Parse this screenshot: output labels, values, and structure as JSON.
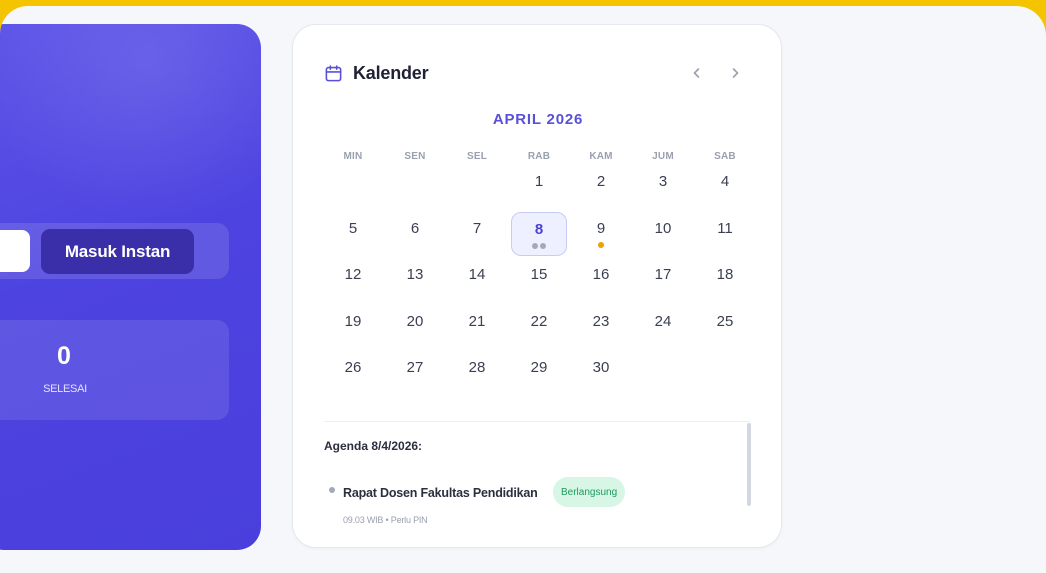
{
  "hero": {
    "instant_button_label": "Masuk Instan",
    "stat_value": "0",
    "stat_label": "SELESAI",
    "accent": "#4d43e0"
  },
  "calendar": {
    "title": "Kalender",
    "icon": "calendar-icon",
    "prev_icon": "chevron-left-icon",
    "next_icon": "chevron-right-icon",
    "month_label": "APRIL 2026",
    "weekdays": [
      "MIN",
      "SEN",
      "SEL",
      "RAB",
      "KAM",
      "JUM",
      "SAB"
    ],
    "weeks": [
      [
        "",
        "",
        "",
        "1",
        "2",
        "3",
        "4"
      ],
      [
        "5",
        "6",
        "7",
        "8",
        "9",
        "10",
        "11"
      ],
      [
        "12",
        "13",
        "14",
        "15",
        "16",
        "17",
        "18"
      ],
      [
        "19",
        "20",
        "21",
        "22",
        "23",
        "24",
        "25"
      ],
      [
        "26",
        "27",
        "28",
        "29",
        "30",
        "",
        ""
      ]
    ],
    "selected_day": "8",
    "event_dots": {
      "8": [
        "gray",
        "gray"
      ],
      "9": [
        "orange"
      ]
    },
    "selected_color": "#4b40d4"
  },
  "agenda": {
    "title": "Agenda 8/4/2026:",
    "items": [
      {
        "name": "Rapat Dosen Fakultas Pendidikan",
        "status": "Berlangsung",
        "meta": "09.03 WIB • Perlu PIN",
        "status_color": "#1f9a5e"
      }
    ]
  }
}
